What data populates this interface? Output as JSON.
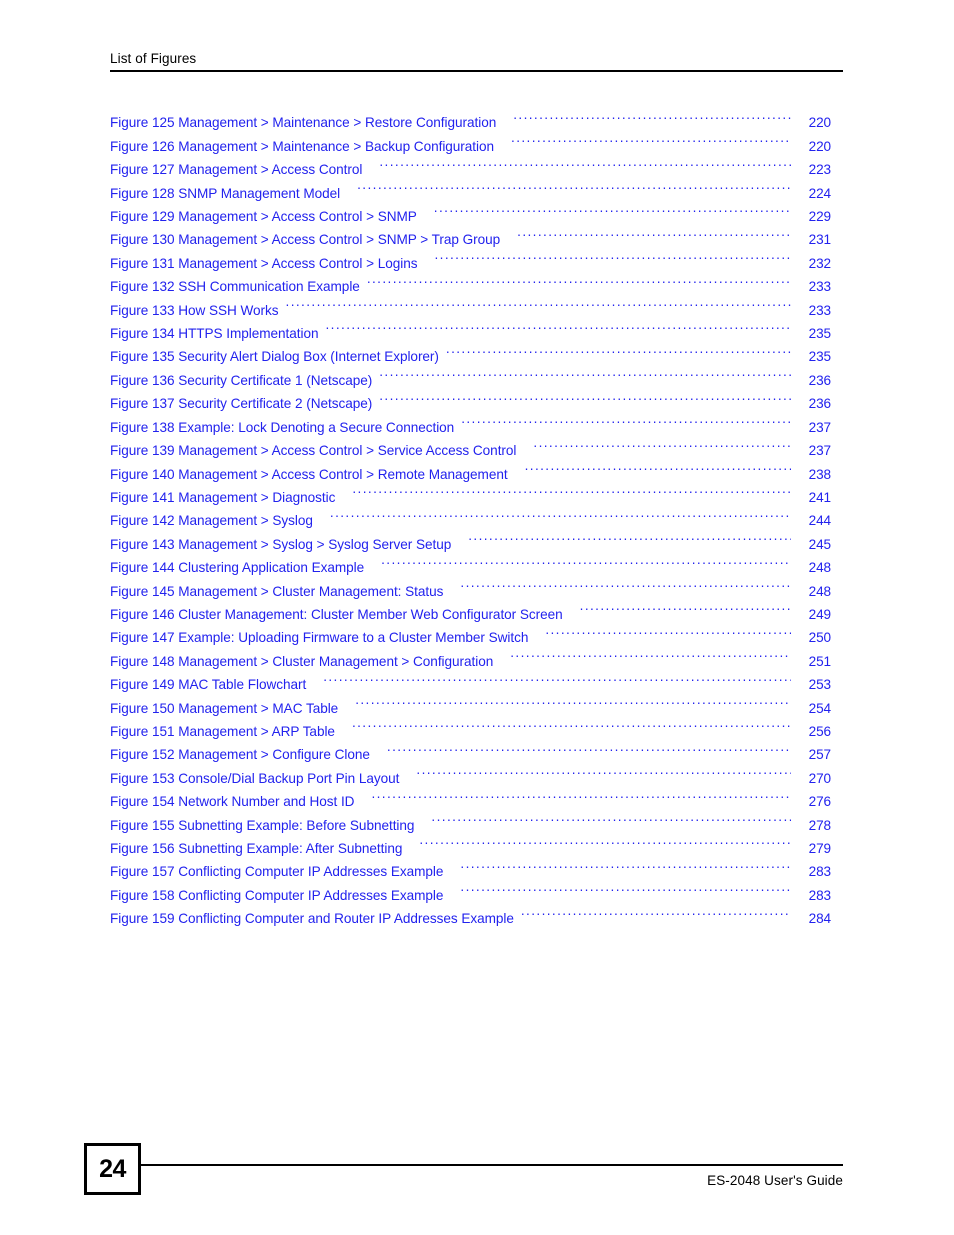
{
  "header": {
    "title": "List of Figures"
  },
  "footer": {
    "page_number": "24",
    "guide_label": "ES-2048 User's Guide"
  },
  "colors": {
    "link_blue": "#2222ee",
    "text_black": "#000000",
    "page_background": "#ffffff"
  },
  "list_of_figures": {
    "entries": [
      {
        "title": "Figure 125 Management > Maintenance > Restore Configuration",
        "page": "220",
        "gap": "wide"
      },
      {
        "title": "Figure 126 Management > Maintenance > Backup Configuration",
        "page": "220",
        "gap": "wide"
      },
      {
        "title": "Figure 127 Management > Access Control",
        "page": "223",
        "gap": "wide"
      },
      {
        "title": "Figure 128 SNMP Management Model",
        "page": "224",
        "gap": "wide"
      },
      {
        "title": "Figure 129 Management > Access Control > SNMP",
        "page": "229",
        "gap": "wide"
      },
      {
        "title": "Figure 130 Management > Access Control > SNMP > Trap Group",
        "page": "231",
        "gap": "wide"
      },
      {
        "title": "Figure 131 Management > Access Control > Logins",
        "page": "232",
        "gap": "wide"
      },
      {
        "title": "Figure 132 SSH Communication Example",
        "page": "233",
        "gap": "normal"
      },
      {
        "title": "Figure 133 How SSH Works",
        "page": "233",
        "gap": "normal"
      },
      {
        "title": "Figure 134 HTTPS Implementation",
        "page": "235",
        "gap": "normal"
      },
      {
        "title": "Figure 135 Security Alert Dialog Box (Internet Explorer)",
        "page": "235",
        "gap": "normal"
      },
      {
        "title": "Figure 136 Security Certificate 1 (Netscape)",
        "page": "236",
        "gap": "normal"
      },
      {
        "title": "Figure 137 Security Certificate 2 (Netscape)",
        "page": "236",
        "gap": "normal"
      },
      {
        "title": "Figure 138 Example: Lock Denoting a Secure Connection",
        "page": "237",
        "gap": "normal"
      },
      {
        "title": "Figure 139 Management > Access Control > Service Access Control",
        "page": "237",
        "gap": "wide"
      },
      {
        "title": "Figure 140 Management > Access Control > Remote Management",
        "page": "238",
        "gap": "wide"
      },
      {
        "title": "Figure 141 Management > Diagnostic",
        "page": "241",
        "gap": "wide"
      },
      {
        "title": "Figure 142 Management > Syslog",
        "page": "244",
        "gap": "wide"
      },
      {
        "title": "Figure 143 Management > Syslog > Syslog Server Setup",
        "page": "245",
        "gap": "wide"
      },
      {
        "title": "Figure 144 Clustering Application Example",
        "page": "248",
        "gap": "wide"
      },
      {
        "title": "Figure 145 Management > Cluster Management: Status",
        "page": "248",
        "gap": "wide"
      },
      {
        "title": "Figure 146 Cluster Management: Cluster Member Web Configurator Screen",
        "page": "249",
        "gap": "wide"
      },
      {
        "title": "Figure 147 Example: Uploading Firmware to a Cluster Member Switch",
        "page": "250",
        "gap": "wide"
      },
      {
        "title": "Figure 148 Management > Cluster Management > Configuration",
        "page": "251",
        "gap": "wide"
      },
      {
        "title": "Figure 149 MAC Table Flowchart",
        "page": "253",
        "gap": "wide"
      },
      {
        "title": "Figure 150 Management > MAC Table",
        "page": "254",
        "gap": "wide"
      },
      {
        "title": "Figure 151 Management > ARP Table",
        "page": "256",
        "gap": "wide"
      },
      {
        "title": "Figure 152 Management > Configure Clone",
        "page": "257",
        "gap": "wide"
      },
      {
        "title": "Figure 153 Console/Dial Backup Port Pin Layout",
        "page": "270",
        "gap": "wide"
      },
      {
        "title": "Figure 154 Network Number and Host ID",
        "page": "276",
        "gap": "wide"
      },
      {
        "title": "Figure 155 Subnetting Example: Before Subnetting",
        "page": "278",
        "gap": "wide"
      },
      {
        "title": "Figure 156 Subnetting Example: After Subnetting",
        "page": "279",
        "gap": "wide"
      },
      {
        "title": "Figure 157 Conflicting Computer IP Addresses Example",
        "page": "283",
        "gap": "wide"
      },
      {
        "title": "Figure 158 Conflicting Computer IP Addresses Example",
        "page": "283",
        "gap": "wide"
      },
      {
        "title": "Figure 159 Conflicting Computer and Router IP Addresses Example",
        "page": "284",
        "gap": "normal"
      }
    ]
  }
}
